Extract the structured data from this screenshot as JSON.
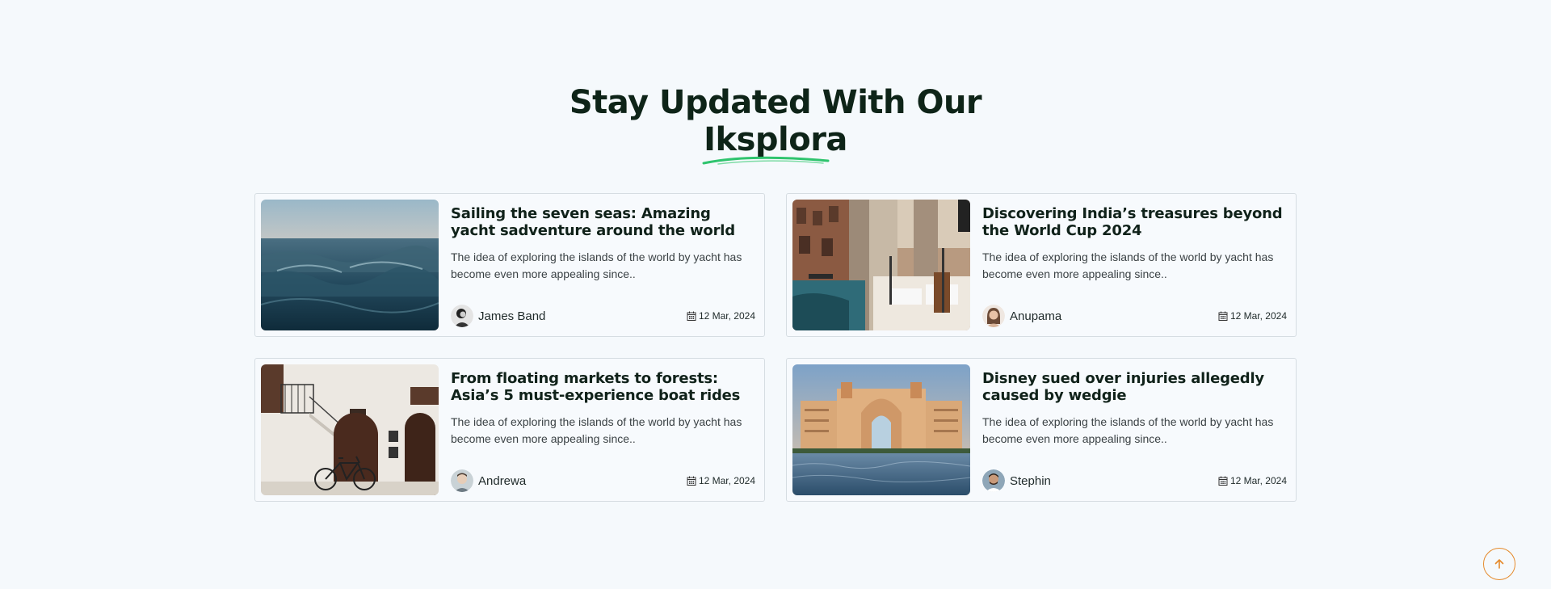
{
  "section": {
    "title_line1": "Stay Updated With Our",
    "title_line2": "Iksplora",
    "underline_color": "#2fc46e"
  },
  "posts": [
    {
      "title": "Sailing the seven seas: Amazing yacht sadventure around the world",
      "excerpt": "The idea of exploring the islands of the world by yacht has become even more appealing since..",
      "author": "James Band",
      "date": "12 Mar, 2024",
      "image": "ocean-waves"
    },
    {
      "title": "Discovering India’s treasures beyond the World Cup 2024",
      "excerpt": "The idea of exploring the islands of the world by yacht has become even more appealing since..",
      "author": "Anupama",
      "date": "12 Mar, 2024",
      "image": "venice-canal-cafe"
    },
    {
      "title": "From floating markets to forests: Asia’s 5 must-experience boat rides",
      "excerpt": "The idea of exploring the islands of the world by yacht has become even more appealing since..",
      "author": "Andrewa",
      "date": "12 Mar, 2024",
      "image": "white-street-bicycle"
    },
    {
      "title": "Disney sued over injuries allegedly caused by wedgie",
      "excerpt": "The idea of exploring the islands of the world by yacht has become even more appealing since..",
      "author": "Stephin",
      "date": "12 Mar, 2024",
      "image": "atlantis-hotel-sea"
    }
  ],
  "icons": {
    "date": "calendar-icon",
    "scroll_top": "arrow-up-icon"
  },
  "colors": {
    "accent_orange": "#e58a2b",
    "heading": "#0e2418"
  }
}
